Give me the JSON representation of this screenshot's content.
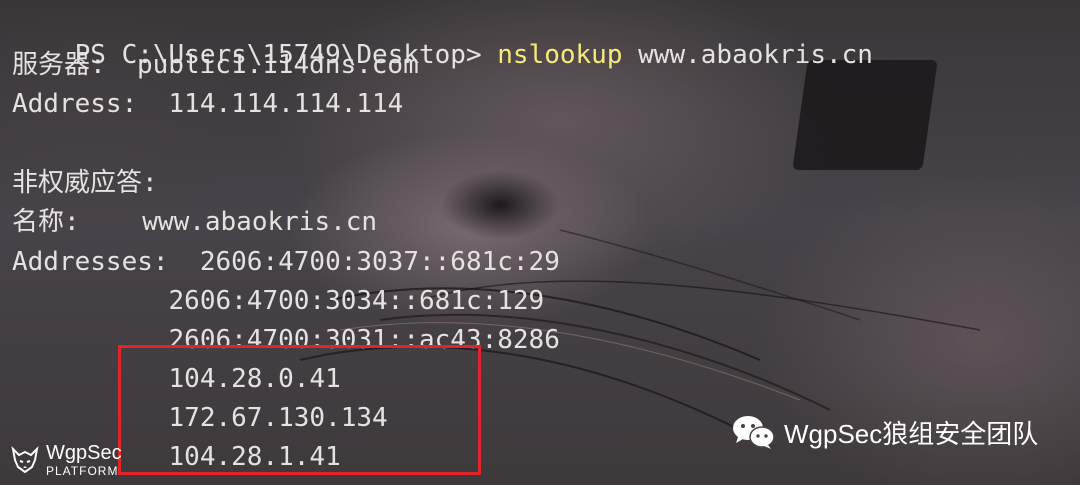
{
  "terminal": {
    "prompt": "PS C:\\Users\\15749\\Desktop> ",
    "command": "nslookup",
    "argument": " www.abaokris.cn",
    "server_line": "服务器:  public1.114dns.com",
    "server_address_line": "Address:  114.114.114.114",
    "non_auth_line": "非权威应答:",
    "name_line": "名称:    www.abaokris.cn",
    "addresses": [
      "Addresses:  2606:4700:3037::681c:29",
      "          2606:4700:3034::681c:129",
      "          2606:4700:3031::ac43:8286",
      "          104.28.0.41",
      "          172.67.130.134",
      "          104.28.1.41"
    ],
    "highlight_color": "#e0242a",
    "command_color": "#f7ea7a"
  },
  "branding": {
    "logo_name": "WgpSec",
    "logo_sub": "PLATFORM",
    "logo_icon": "wolf-icon",
    "watermark_text": "WgpSec狼组安全团队",
    "watermark_icon": "wechat-icon"
  }
}
